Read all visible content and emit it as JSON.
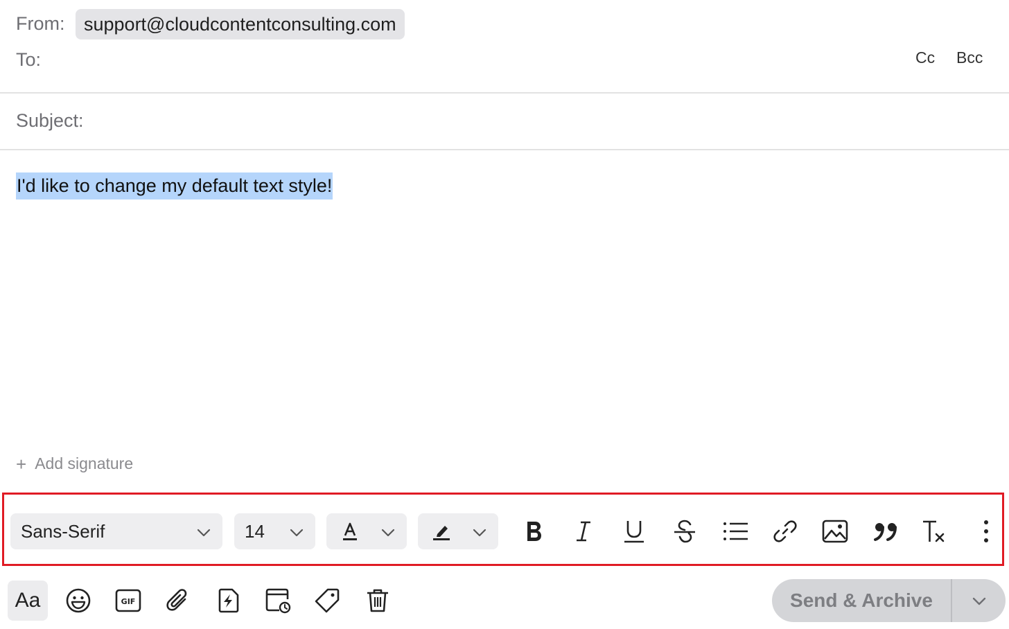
{
  "header": {
    "from_label": "From:",
    "from_value": "support@cloudcontentconsulting.com",
    "to_label": "To:",
    "cc_label": "Cc",
    "bcc_label": "Bcc",
    "subject_label": "Subject:"
  },
  "body": {
    "text": "I'd like to change my default text style!",
    "add_signature_label": "Add signature"
  },
  "format_toolbar": {
    "font_family": "Sans-Serif",
    "font_size": "14",
    "icons": [
      "text-color-icon",
      "highlight-icon",
      "bold-icon",
      "italic-icon",
      "underline-icon",
      "strikethrough-icon",
      "bulleted-list-icon",
      "link-icon",
      "image-icon",
      "quote-icon",
      "clear-formatting-icon",
      "more-options-icon"
    ]
  },
  "bottom_bar": {
    "format_button_label": "Aa",
    "send_label": "Send & Archive",
    "icons": [
      "emoji-icon",
      "gif-icon",
      "attachment-icon",
      "snippet-icon",
      "schedule-icon",
      "label-icon",
      "trash-icon"
    ]
  },
  "colors": {
    "selection_highlight": "#b5d5fb",
    "toolbar_outline": "#e01b24",
    "send_button_bg": "#d4d5d8"
  }
}
